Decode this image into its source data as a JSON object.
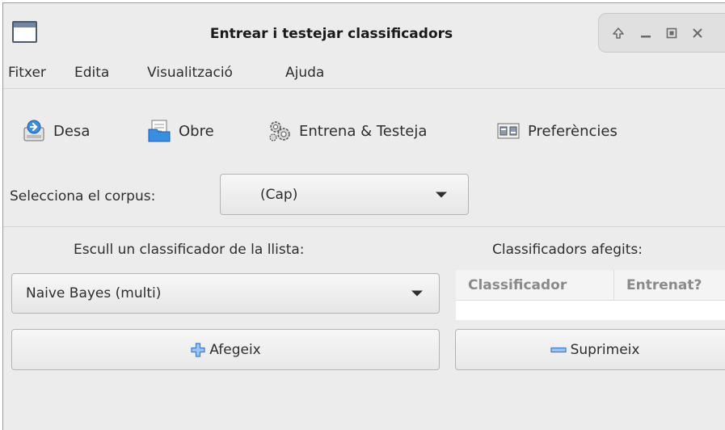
{
  "window": {
    "title": "Entrear i testejar classificadors"
  },
  "menu": [
    "Fitxer",
    "Edita",
    "Visualització",
    "Ajuda"
  ],
  "toolbar": {
    "save_label": "Desa",
    "open_label": "Obre",
    "train_label": "Entrena & Testeja",
    "prefs_label": "Preferències"
  },
  "corpus": {
    "label": "Selecciona el corpus:",
    "selected": "(Cap)"
  },
  "left_panel": {
    "title": "Escull un classificador de la llista:",
    "selected_classifier": "Naive Bayes (multi)",
    "add_label": "Afegeix"
  },
  "right_panel": {
    "title": "Classificadors afegits:",
    "columns": [
      "Classificador",
      "Entrenat?"
    ],
    "rows": [],
    "remove_label": "Suprimeix"
  },
  "colors": {
    "add_icon": "#3c7bd6",
    "remove_icon": "#3c7bd6"
  }
}
